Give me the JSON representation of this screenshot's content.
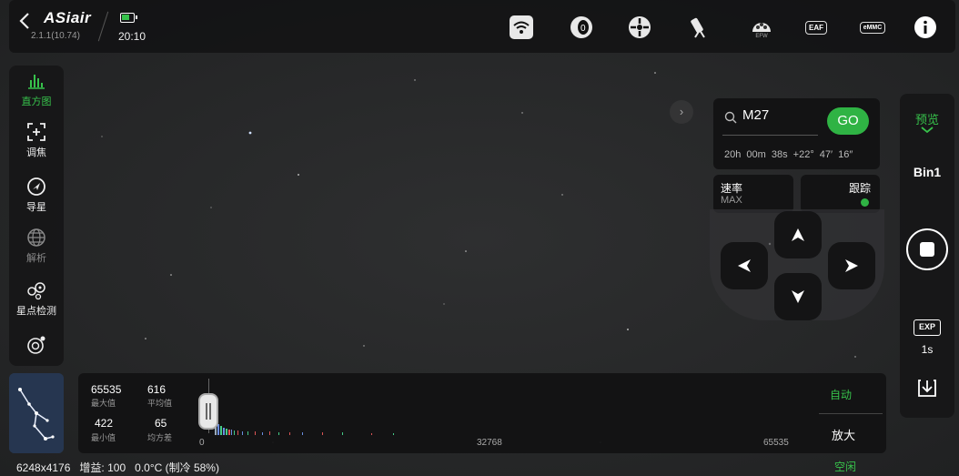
{
  "header": {
    "back_icon": "chevron-left-icon",
    "logo": "ASiair",
    "version": "2.1.1(10.74)",
    "battery_icon": "battery-icon",
    "time": "20:10",
    "icons": [
      "wifi-icon",
      "focuser-icon",
      "mount-icon",
      "telescope-icon",
      "filter-wheel-icon",
      "eaf-icon",
      "emmc-icon",
      "info-icon"
    ],
    "efw_label": "EFW",
    "eaf_label": "EAF",
    "emmc_label": "eMMC"
  },
  "left_tools": [
    {
      "label": "直方图",
      "icon": "histogram-icon",
      "active": true
    },
    {
      "label": "调焦",
      "icon": "focus-icon",
      "active": false
    },
    {
      "label": "导星",
      "icon": "guide-icon",
      "active": false
    },
    {
      "label": "解析",
      "icon": "globe-icon",
      "active": false
    },
    {
      "label": "星点检测",
      "icon": "star-detect-icon",
      "active": false
    },
    {
      "label": "",
      "icon": "camera-settings-icon",
      "active": false
    }
  ],
  "goto": {
    "target": "M27",
    "go_label": "GO",
    "ra": "20h 00m 38s",
    "dec": "+22° 47′ 16″"
  },
  "mount": {
    "rate_label": "速率",
    "rate_value": "MAX",
    "track_label": "跟踪",
    "track_on": true
  },
  "right_panel": {
    "mode": "预览",
    "bin": "Bin1",
    "exposure_icon_label": "EXP",
    "exposure": "1s"
  },
  "histogram": {
    "max_value": "65535",
    "max_label": "最大值",
    "mean_value": "616",
    "mean_label": "平均值",
    "min_value": "422",
    "min_label": "最小值",
    "std_value": "65",
    "std_label": "均方差",
    "axis_min": "0",
    "axis_mid": "32768",
    "axis_max": "65535",
    "auto_label": "自动",
    "zoom_label": "放大"
  },
  "status": {
    "resolution": "6248x4176",
    "gain_label": "增益:",
    "gain_value": "100",
    "temp": "0.0°C (制冷 58%)",
    "state": "空闲"
  },
  "colors": {
    "accent": "#2fb344",
    "panel": "#141415"
  }
}
